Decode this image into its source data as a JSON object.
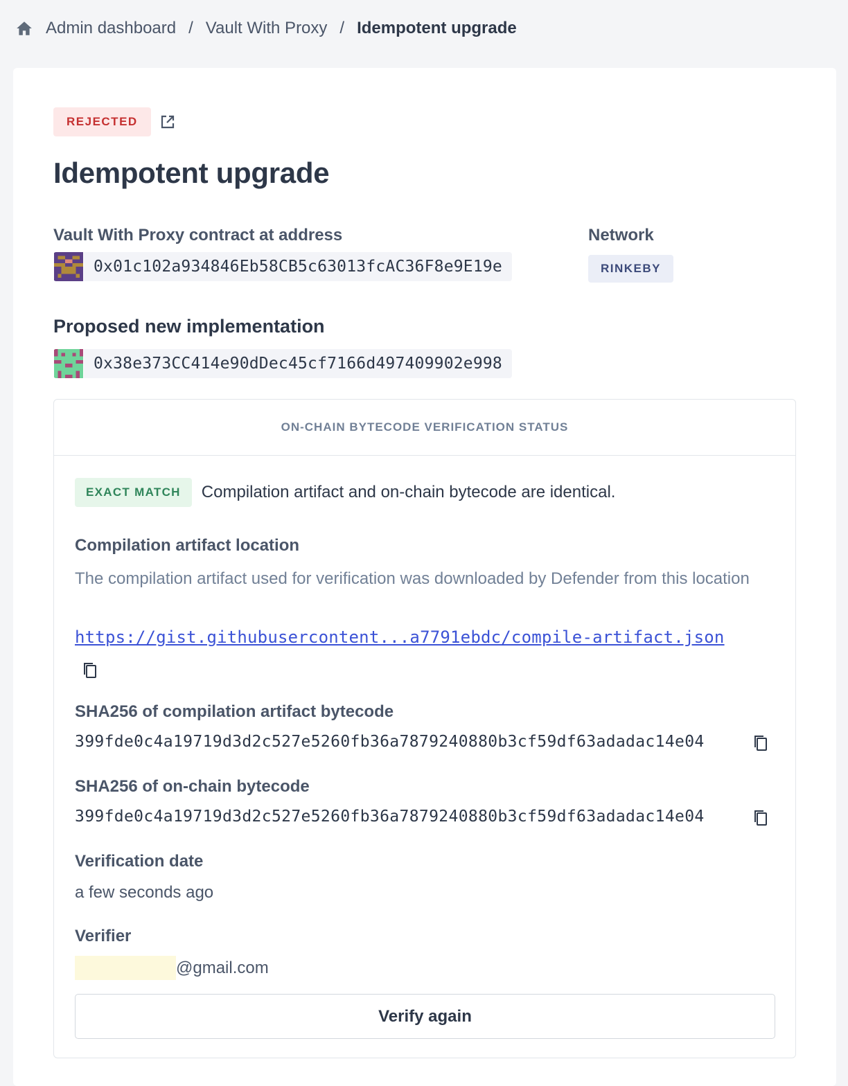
{
  "breadcrumb": {
    "home_icon": "home-icon",
    "items": [
      "Admin dashboard",
      "Vault With Proxy"
    ],
    "separator": "/",
    "current": "Idempotent upgrade"
  },
  "proposal": {
    "status": "REJECTED",
    "status_color": "#c53030",
    "external_link_icon": "external-link-icon",
    "title": "Idempotent upgrade",
    "contract_label": "Vault With Proxy contract at address",
    "contract_address": "0x01c102a934846Eb58CB5c63013fcAC36F8e9E19e",
    "network_label": "Network",
    "network": "RINKEBY",
    "implementation_label": "Proposed new implementation",
    "implementation_address": "0x38e373CC414e90dDec45cf7166d497409902e998"
  },
  "verification": {
    "header": "ON-CHAIN BYTECODE VERIFICATION STATUS",
    "match_badge": "EXACT MATCH",
    "match_color": "#2f855a",
    "match_text": "Compilation artifact and on-chain bytecode are identical.",
    "artifact_location_label": "Compilation artifact location",
    "artifact_location_desc": "The compilation artifact used for verification was downloaded by Defender from this location",
    "artifact_url": "https://gist.githubusercontent...a7791ebdc/compile-artifact.json",
    "artifact_sha_label": "SHA256 of compilation artifact bytecode",
    "artifact_sha": "399fde0c4a19719d3d2c527e5260fb36a7879240880b3cf59df63adadac14e04",
    "onchain_sha_label": "SHA256 of on-chain bytecode",
    "onchain_sha": "399fde0c4a19719d3d2c527e5260fb36a7879240880b3cf59df63adadac14e04",
    "date_label": "Verification date",
    "date_value": "a few seconds ago",
    "verifier_label": "Verifier",
    "verifier_email": "@gmail.com",
    "verify_button": "Verify again",
    "copy_icon": "copy-icon"
  }
}
